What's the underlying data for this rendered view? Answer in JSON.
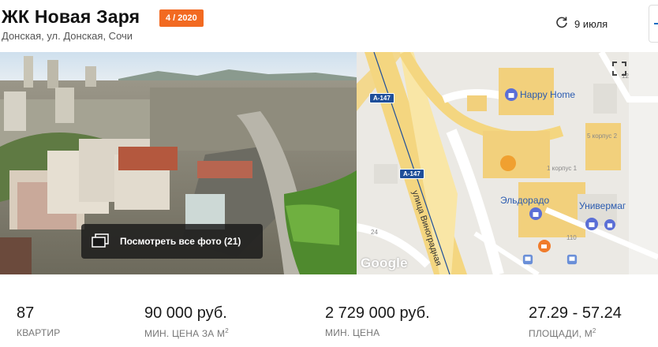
{
  "header": {
    "title": "ЖК Новая Заря",
    "badge": "4 / 2020",
    "address": "Донская, ул. Донская, Сочи",
    "date": "9 июля",
    "badge_color": "#f26a21"
  },
  "gallery": {
    "photos_button": "Посмотреть все фото (21)"
  },
  "map": {
    "poi_happy_home": "Happy Home",
    "poi_eldorado": "Эльдорадо",
    "poi_univermag": "Универмаг",
    "road_shield_1": "A-147",
    "road_shield_2": "A-147",
    "street": "улица Виноградная",
    "label_korpus2": "5 корпус 2",
    "label_korpus1": "1 корпус 1",
    "label_24": "24",
    "label_110": "110",
    "label_12": "12",
    "attribution": "Google",
    "pin_color": "#f0a030"
  },
  "stats": [
    {
      "value": "87",
      "label": "КВАРТИР",
      "sup": ""
    },
    {
      "value": "90 000 руб.",
      "label": "МИН. ЦЕНА ЗА М",
      "sup": "2"
    },
    {
      "value": "2 729 000 руб.",
      "label": "МИН. ЦЕНА",
      "sup": ""
    },
    {
      "value": "27.29 - 57.24",
      "label": "ПЛОЩАДИ, М",
      "sup": "2"
    }
  ]
}
